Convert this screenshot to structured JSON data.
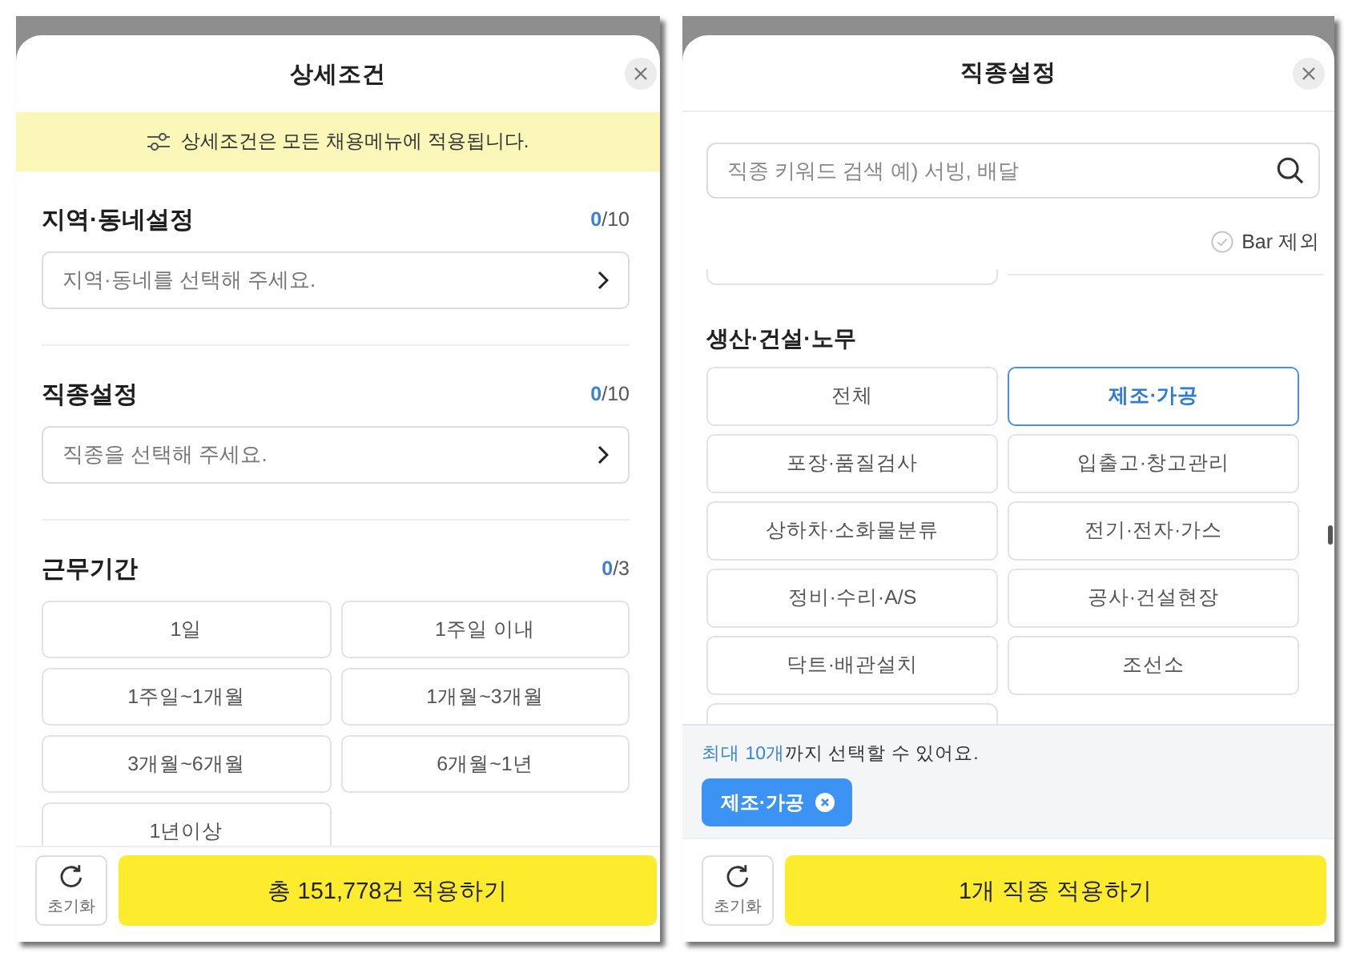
{
  "detail_modal": {
    "title": "상세조건",
    "notice": "상세조건은 모든 채용메뉴에 적용됩니다.",
    "sections": [
      {
        "kind": "select",
        "title": "지역·동네설정",
        "count": "**0**/10",
        "placeholder": "지역·동네를 선택해 주세요."
      },
      {
        "kind": "select",
        "title": "직종설정",
        "count": "**0**/10",
        "placeholder": "직종을 선택해 주세요."
      },
      {
        "kind": "options",
        "title": "근무기간",
        "count": "**0**/3",
        "options": [
          {
            "label": "1일",
            "selected": false
          },
          {
            "label": "1주일 이내",
            "selected": false
          },
          {
            "label": "1주일~1개월",
            "selected": false
          },
          {
            "label": "1개월~3개월",
            "selected": false
          },
          {
            "label": "3개월~6개월",
            "selected": false
          },
          {
            "label": "6개월~1년",
            "selected": false
          },
          {
            "label": "1년이상",
            "selected": false
          }
        ]
      }
    ],
    "footer": {
      "reset_label": "초기화",
      "apply_label": "총 151,778건 적용하기"
    }
  },
  "job_modal": {
    "title": "직종설정",
    "search": {
      "placeholder": "직종 키워드 검색 예) 서빙, 배달"
    },
    "exclude_bar": {
      "label": "Bar 제외",
      "checked": false
    },
    "category": {
      "title": "생산·건설·노무",
      "options": [
        {
          "label": "전체",
          "selected": false
        },
        {
          "label": "제조·가공",
          "selected": true
        },
        {
          "label": "포장·품질검사",
          "selected": false
        },
        {
          "label": "입출고·창고관리",
          "selected": false
        },
        {
          "label": "상하차·소화물분류",
          "selected": false
        },
        {
          "label": "전기·전자·가스",
          "selected": false
        },
        {
          "label": "정비·수리·A/S",
          "selected": false
        },
        {
          "label": "공사·건설현장",
          "selected": false
        },
        {
          "label": "닥트·배관설치",
          "selected": false
        },
        {
          "label": "조선소",
          "selected": false
        }
      ]
    },
    "limit_note": "**최대 10개**까지 선택할 수 있어요.",
    "selected_tags": [
      {
        "label": "제조·가공"
      }
    ],
    "footer": {
      "reset_label": "초기화",
      "apply_label": "1개 직종 적용하기"
    }
  }
}
